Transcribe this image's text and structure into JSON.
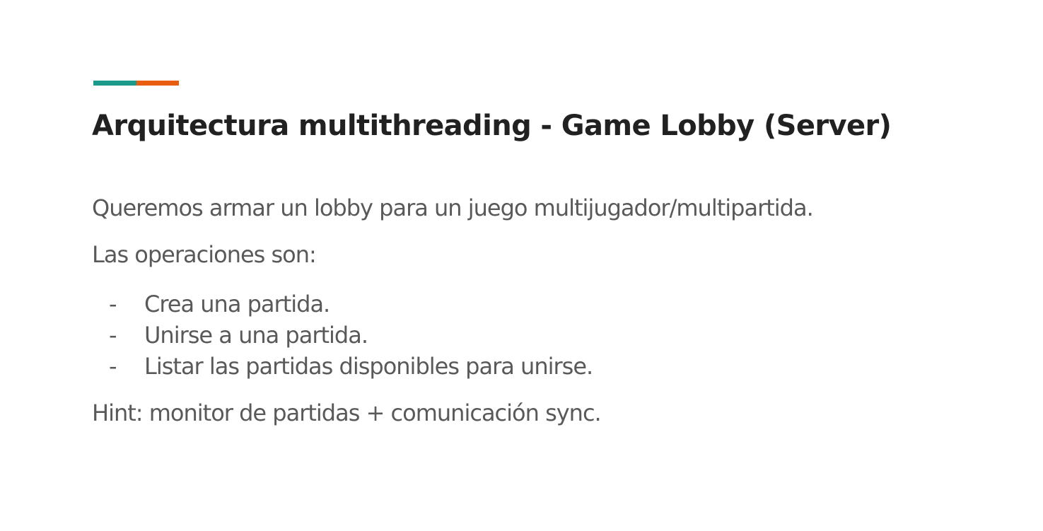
{
  "colors": {
    "accent_teal": "#1b998b",
    "accent_orange": "#e85d0f",
    "title_color": "#212121",
    "body_color": "#595959",
    "background": "#ffffff"
  },
  "slide": {
    "title": "Arquitectura multithreading - Game Lobby (Server)",
    "paragraph_1": "Queremos armar un lobby para un juego multijugador/multipartida.",
    "paragraph_2": "Las operaciones son:",
    "bullet_marker": "-",
    "bullets": [
      "Crea una partida.",
      "Unirse a una partida.",
      "Listar las partidas disponibles para unirse."
    ],
    "hint": "Hint: monitor de partidas + comunicación sync."
  }
}
